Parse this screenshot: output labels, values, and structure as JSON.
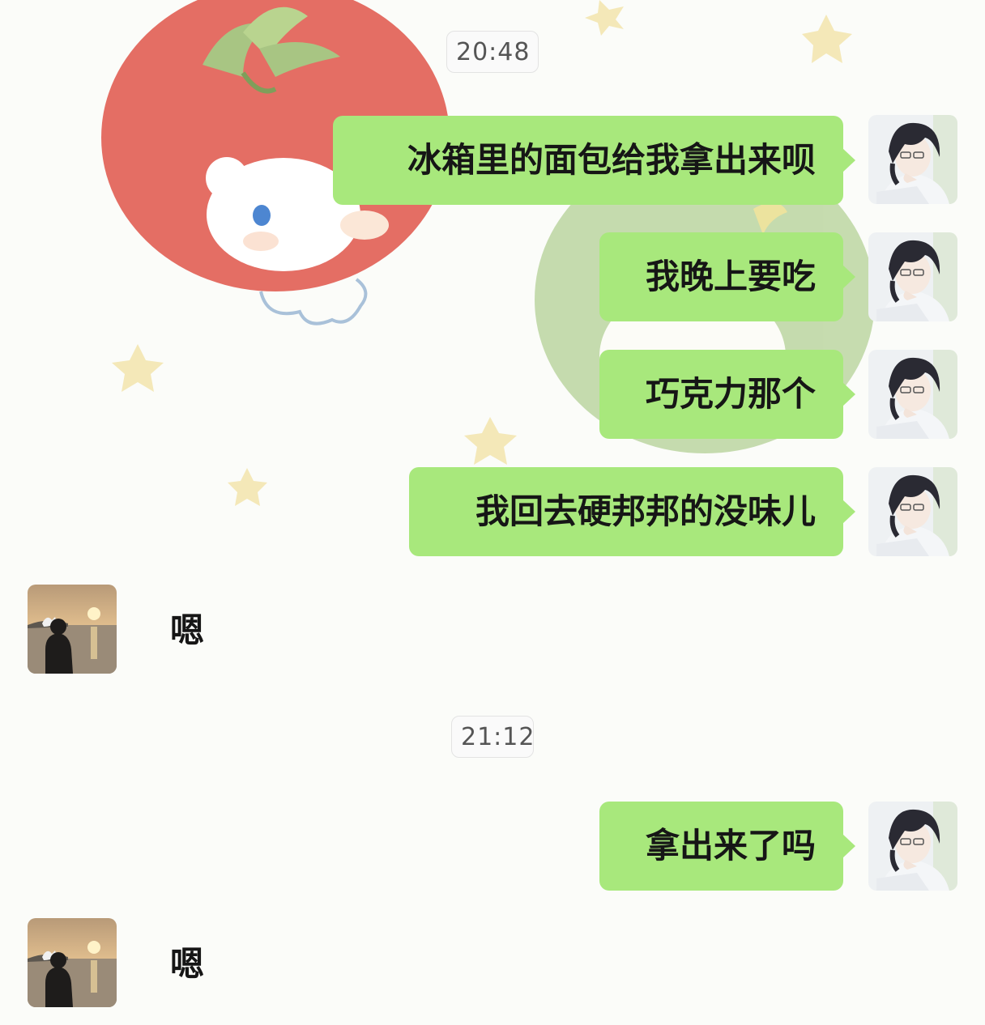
{
  "timestamps": [
    "20:48",
    "21:12"
  ],
  "messages": [
    {
      "sender": "me",
      "text": "冰箱里的面包给我拿出来呗"
    },
    {
      "sender": "me",
      "text": "我晚上要吃"
    },
    {
      "sender": "me",
      "text": "巧克力那个"
    },
    {
      "sender": "me",
      "text": "我回去硬邦邦的没味儿"
    },
    {
      "sender": "other",
      "text": "嗯"
    },
    {
      "sender": "me",
      "text": "拿出来了吗"
    },
    {
      "sender": "other",
      "text": "嗯"
    }
  ],
  "colors": {
    "outgoing_bubble": "#a8e87c",
    "timestamp_bg": "#fafafa",
    "text": "#161616",
    "wallpaper_tomato": "#e46e64",
    "wallpaper_green": "#b6d39a"
  },
  "icons": {
    "my_avatar": "anime-boy-avatar-icon",
    "contact_avatar": "sunset-silhouette-avatar-icon"
  }
}
